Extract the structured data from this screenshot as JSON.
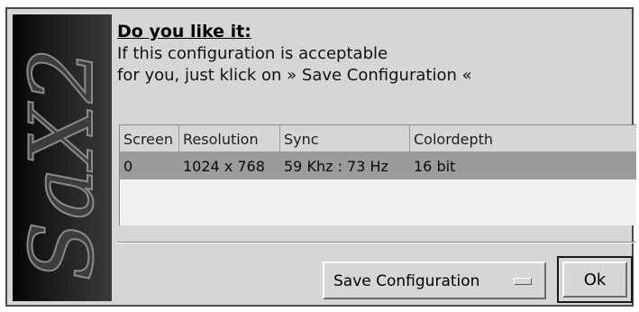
{
  "logo": {
    "text": "SaX2"
  },
  "header": {
    "title": "Do you like it:",
    "line1": "If this configuration is acceptable",
    "line2": "for you, just klick on » Save Configuration «"
  },
  "table": {
    "columns": [
      "Screen",
      "Resolution",
      "Sync",
      "Colordepth"
    ],
    "rows": [
      {
        "screen": "0",
        "resolution": "1024 x 768",
        "sync": "59 Khz : 73 Hz",
        "colordepth": "16 bit"
      }
    ]
  },
  "footer": {
    "action_select": "Save Configuration",
    "ok_label": "Ok"
  }
}
